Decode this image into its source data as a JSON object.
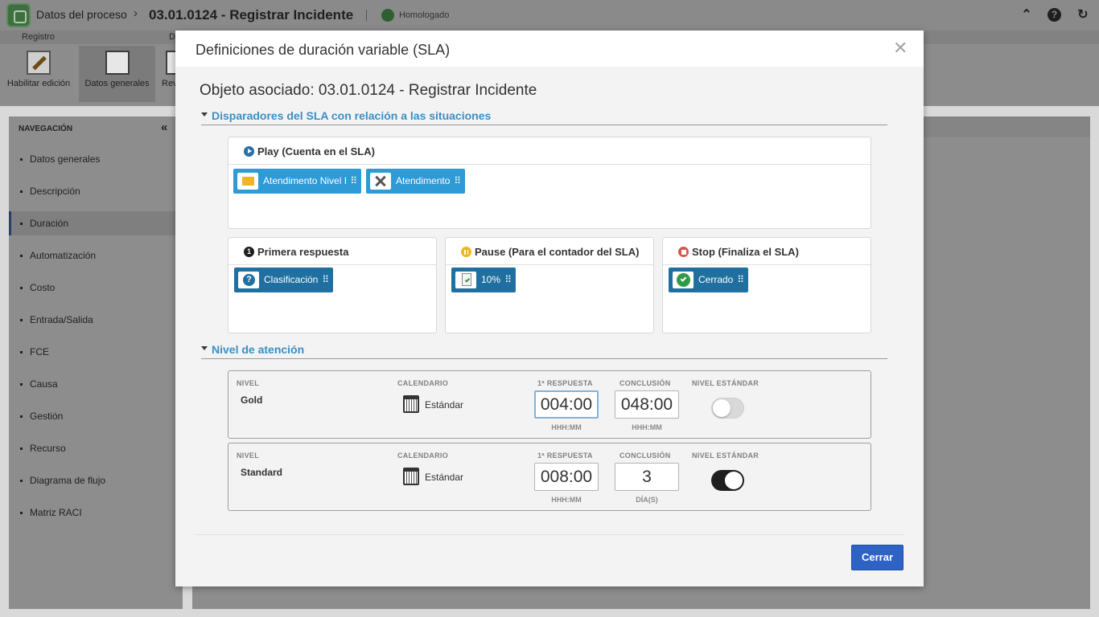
{
  "app": {
    "breadcrumb_1": "Datos del proceso",
    "breadcrumb_separator": "›",
    "breadcrumb_2": "03.01.0124 - Registrar Incidente",
    "status": "Homologado",
    "top_icons": {
      "collapse": "⌃",
      "help": "?",
      "refresh": "↻"
    }
  },
  "ribbon": {
    "tabs": [
      "Registro",
      "D"
    ],
    "buttons": [
      {
        "label": "Habilitar edición",
        "icon": "edit-document-icon"
      },
      {
        "label": "Datos generales",
        "icon": "document-list-icon"
      },
      {
        "label": "Rev",
        "icon": "review-icon"
      }
    ]
  },
  "navigation": {
    "title": "NAVEGACIÓN",
    "collapse_icon": "«",
    "items": [
      "Datos generales",
      "Descripción",
      "Duración",
      "Automatización",
      "Costo",
      "Entrada/Salida",
      "FCE",
      "Causa",
      "Gestión",
      "Recurso",
      "Diagrama de flujo",
      "Matriz RACI"
    ],
    "active_item": "Duración"
  },
  "modal": {
    "title": "Definiciones de duración variable (SLA)",
    "close_symbol": "✕",
    "object_title": "Objeto asociado: 03.01.0124 - Registrar Incidente",
    "section_triggers": "Disparadores del SLA con relación a las situaciones",
    "play": {
      "title": "Play (Cuenta en el SLA)",
      "chips": [
        {
          "label": "Atendimento Nivel I",
          "icon": "folder-icon"
        },
        {
          "label": "Atendimento",
          "icon": "tools-icon"
        }
      ]
    },
    "first_response": {
      "title": "Primera respuesta",
      "icon_text": "1",
      "chips": [
        {
          "label": "Clasificación",
          "icon": "question-icon"
        }
      ]
    },
    "pause": {
      "title": "Pause (Para el contador del SLA)",
      "chips": [
        {
          "label": "10%",
          "icon": "document-check-icon"
        }
      ]
    },
    "stop": {
      "title": "Stop (Finaliza el SLA)",
      "chips": [
        {
          "label": "Cerrado",
          "icon": "check-circle-icon"
        }
      ]
    },
    "drag_symbol": "⠿",
    "section_levels": "Nivel de atención",
    "levels": [
      {
        "label_level": "NIVEL",
        "name": "Gold",
        "label_calendar": "CALENDARIO",
        "calendar": "Estándar",
        "label_first": "1ª RESPUESTA",
        "first_response": "004:00",
        "first_format": "HHH:MM",
        "label_conclusion": "CONCLUSIÓN",
        "conclusion": "048:00",
        "conclusion_format": "HHH:MM",
        "label_standard": "NIVEL ESTÁNDAR",
        "standard": false
      },
      {
        "label_level": "NIVEL",
        "name": "Standard",
        "label_calendar": "CALENDARIO",
        "calendar": "Estándar",
        "label_first": "1ª RESPUESTA",
        "first_response": "008:00",
        "first_format": "HHH:MM",
        "label_conclusion": "CONCLUSIÓN",
        "conclusion": "3",
        "conclusion_format": "DÍA(S)",
        "label_standard": "NIVEL ESTÁNDAR",
        "standard": true
      }
    ],
    "close_button": "Cerrar"
  },
  "colors": {
    "accent_blue": "#3a8fc4",
    "chip_light": "#2e9ad6",
    "chip_dark": "#1f6fa0",
    "button_primary": "#2e62c5",
    "toggle_on": "#1f1f1f",
    "toggle_off": "#d9d9d9"
  }
}
